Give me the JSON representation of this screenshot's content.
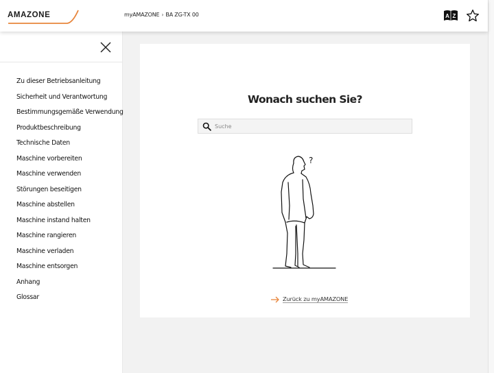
{
  "header": {
    "logo_text": "AMAZONE",
    "breadcrumb": {
      "root": "myAMAZONE",
      "separator": "›",
      "current": "BA ZG-TX 00"
    },
    "icons": {
      "glossary": "glossary-az-book-icon",
      "favorite": "star-outline-icon"
    }
  },
  "sidebar": {
    "close_icon": "close-icon",
    "items": [
      "Zu dieser Betriebsanleitung",
      "Sicherheit und Verantwortung",
      "Bestimmungsgemäße Verwendung",
      "Produktbeschreibung",
      "Technische Daten",
      "Maschine vorbereiten",
      "Maschine verwenden",
      "Störungen beseitigen",
      "Maschine abstellen",
      "Maschine instand halten",
      "Maschine rangieren",
      "Maschine verladen",
      "Maschine entsorgen",
      "Anhang",
      "Glossar"
    ]
  },
  "main": {
    "title": "Wonach suchen Sie?",
    "search": {
      "placeholder": "Suche",
      "value": ""
    },
    "illustration_mark": "?",
    "back_link": "Zurück zu myAMAZONE"
  },
  "colors": {
    "accent": "#e8853b",
    "text": "#1a1a1a",
    "background": "#f2f2f2",
    "card": "#ffffff"
  }
}
